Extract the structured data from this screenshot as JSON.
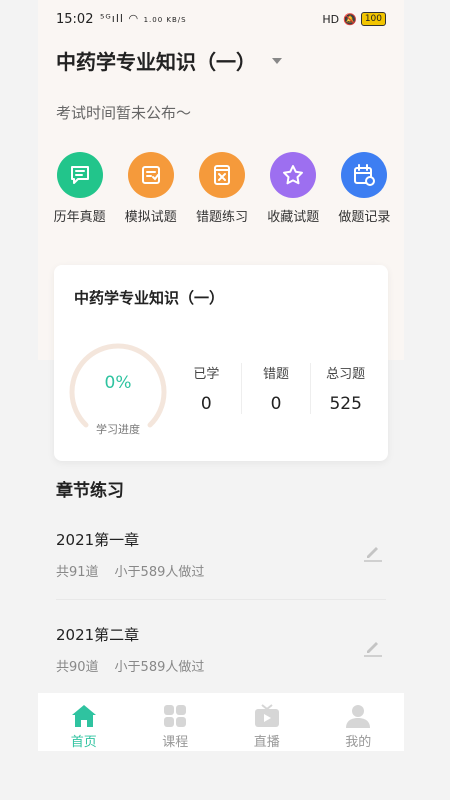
{
  "status_bar": {
    "time": "15:02",
    "signal": "⁵ᴳıll",
    "net_speed": "1.00 KB/S",
    "right_text": "HD",
    "battery": "100"
  },
  "header": {
    "title": "中药学专业知识（一）",
    "exam_time": "考试时间暂未公布～"
  },
  "quick_actions": [
    {
      "label": "历年真题",
      "icon": "book-icon",
      "color": "#22c58b"
    },
    {
      "label": "模拟试题",
      "icon": "checklist-icon",
      "color": "#f59a3b"
    },
    {
      "label": "错题练习",
      "icon": "wrong-doc-icon",
      "color": "#f59a3b"
    },
    {
      "label": "收藏试题",
      "icon": "star-icon",
      "color": "#9d6ff0"
    },
    {
      "label": "做题记录",
      "icon": "calendar-icon",
      "color": "#3d7ef2"
    }
  ],
  "card": {
    "title": "中药学专业知识（一）",
    "progress": {
      "value": "0%",
      "label": "学习进度",
      "fraction": 0
    },
    "stats": [
      {
        "label": "已学",
        "value": "0"
      },
      {
        "label": "错题",
        "value": "0"
      },
      {
        "label": "总习题",
        "value": "525"
      }
    ]
  },
  "section": {
    "title": "章节练习"
  },
  "chapters": [
    {
      "name": "2021第一章",
      "count": "共91道",
      "people": "小于589人做过"
    },
    {
      "name": "2021第二章",
      "count": "共90道",
      "people": "小于589人做过"
    }
  ],
  "tabbar": [
    {
      "label": "首页",
      "icon": "home-icon",
      "active": true
    },
    {
      "label": "课程",
      "icon": "grid-icon",
      "active": false
    },
    {
      "label": "直播",
      "icon": "tv-icon",
      "active": false
    },
    {
      "label": "我的",
      "icon": "person-icon",
      "active": false
    }
  ],
  "colors": {
    "accent": "#2fc3a0",
    "ring_track": "#f4e6dc"
  }
}
